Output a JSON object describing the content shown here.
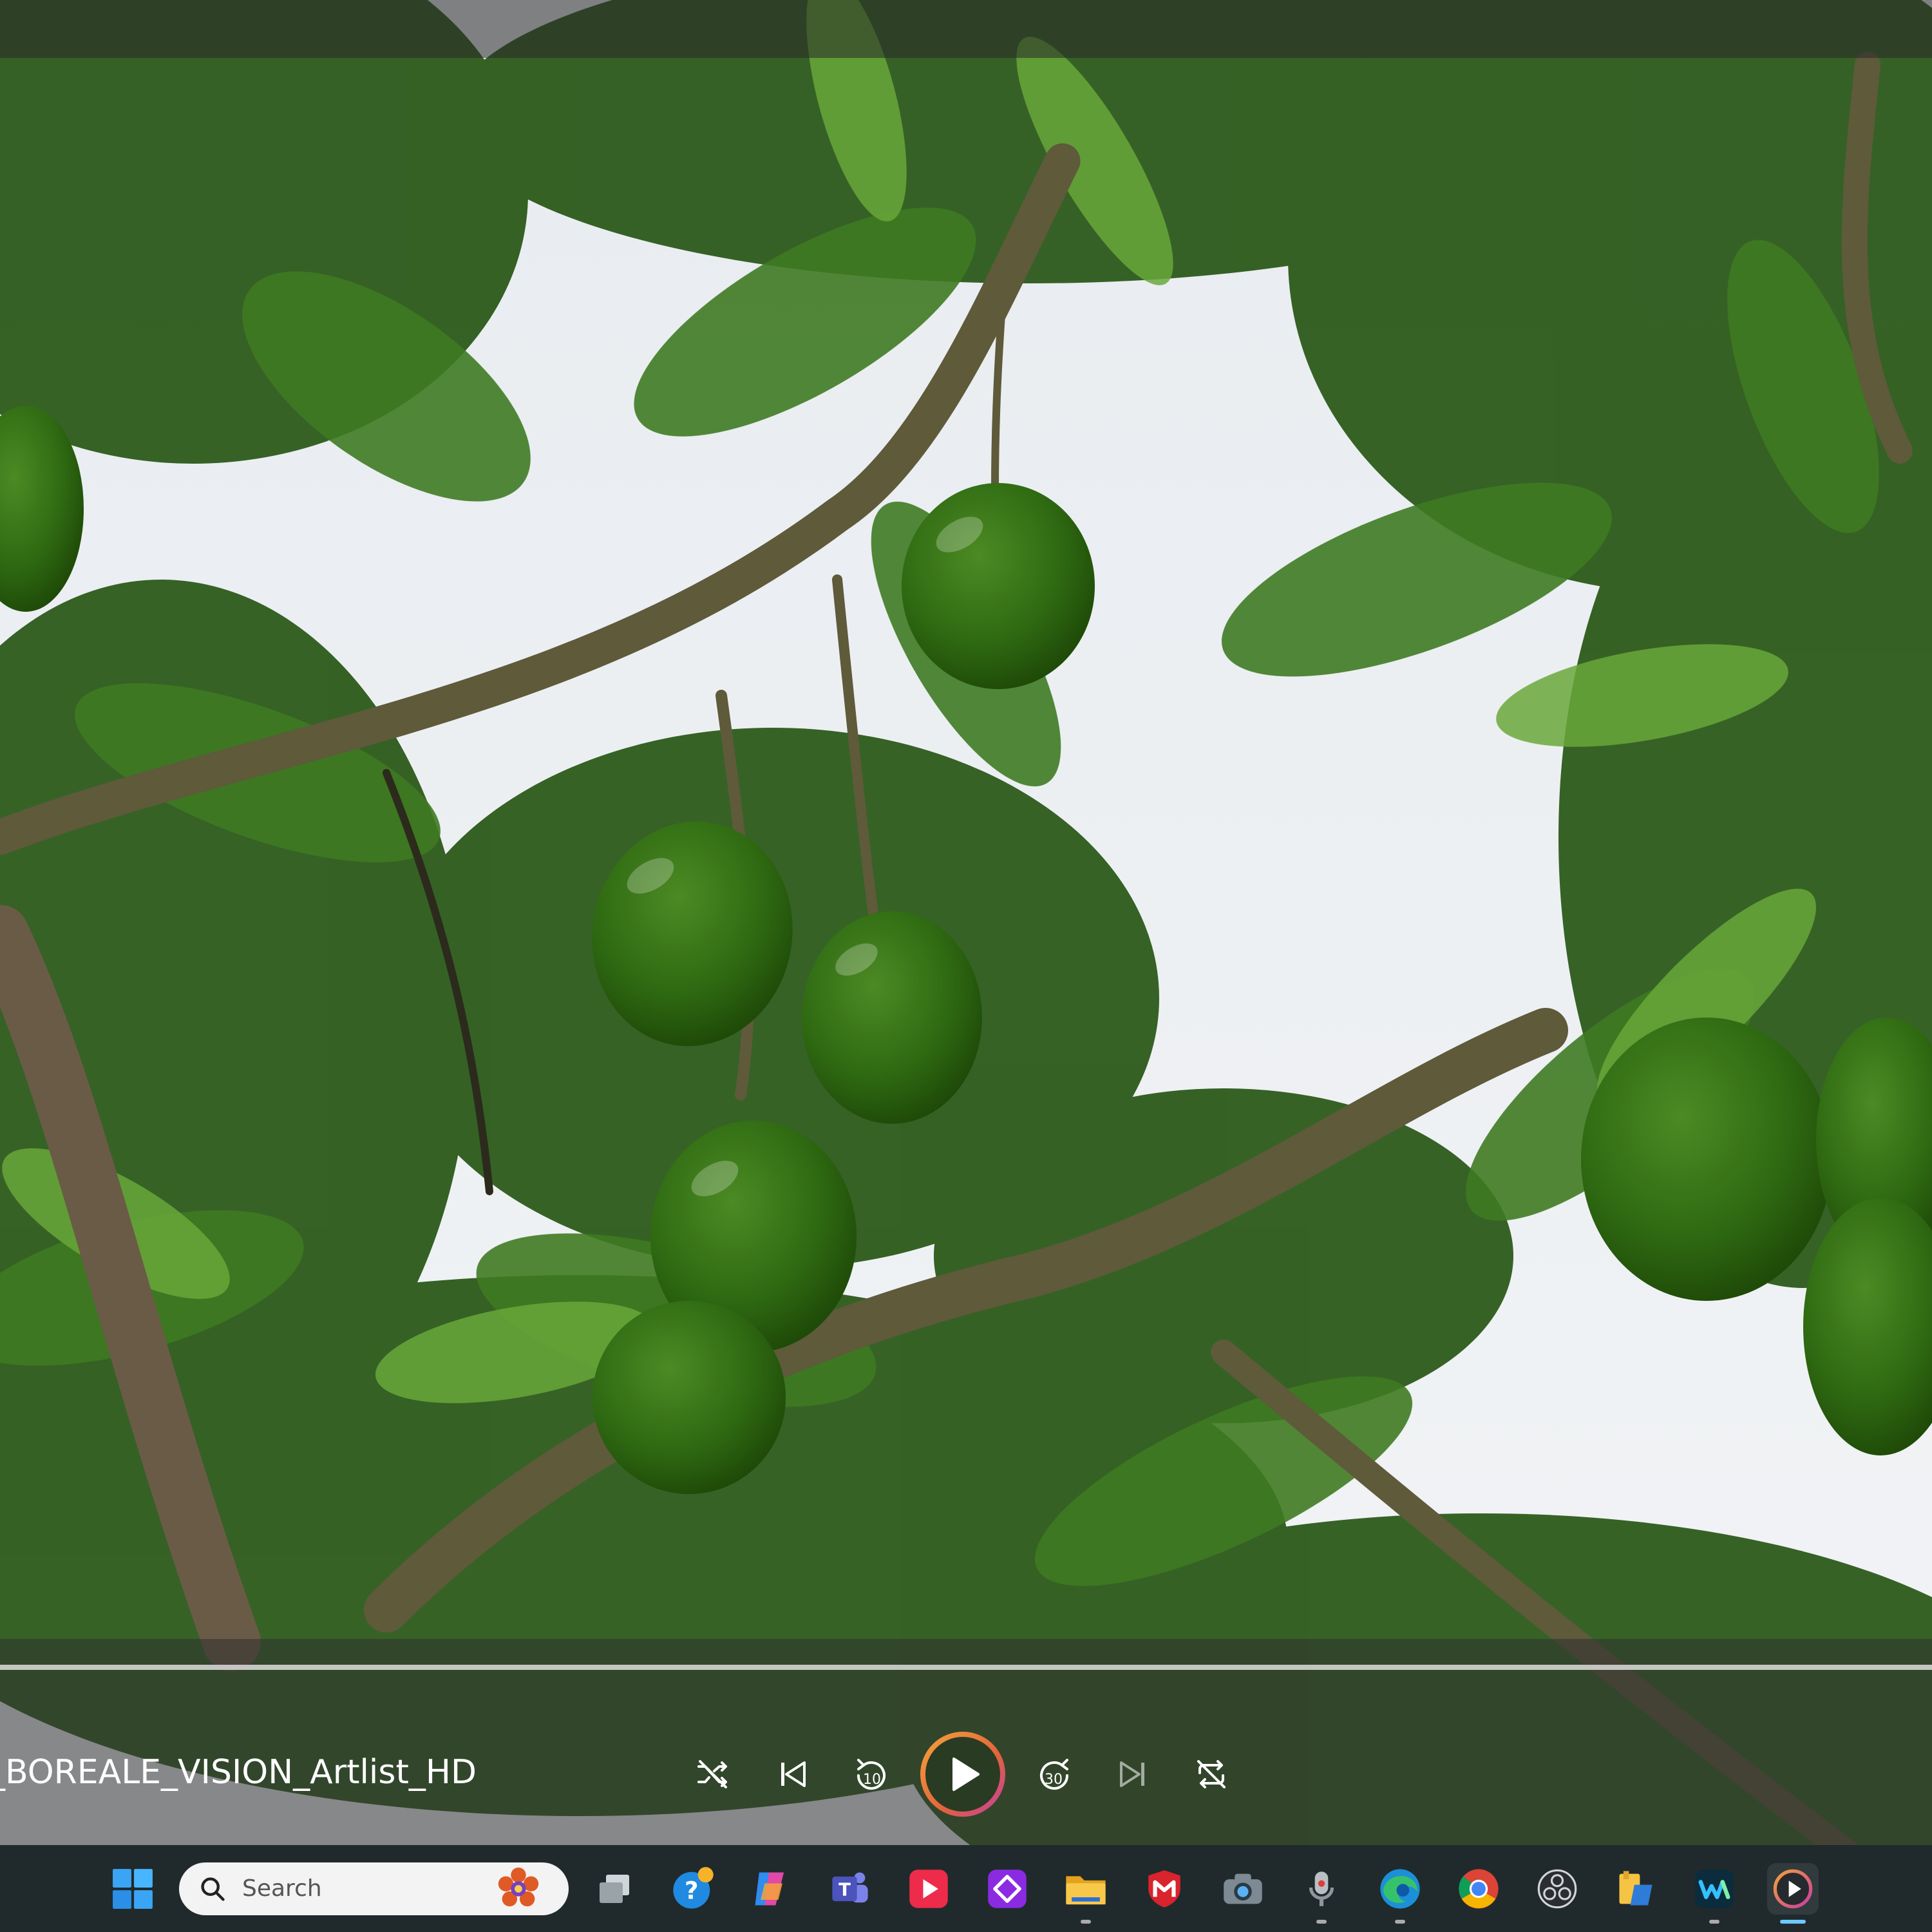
{
  "player": {
    "title": "y_BOREALE_VISION_Artlist_HD",
    "progress_fraction": 0.0,
    "skip_back_seconds": "10",
    "skip_forward_seconds": "30",
    "accent_color": "#e8902c"
  },
  "controls": [
    {
      "name": "shuffle-button",
      "icon": "shuffle-icon"
    },
    {
      "name": "previous-button",
      "icon": "skip-previous-icon"
    },
    {
      "name": "rewind-10-button",
      "icon": "rewind-10-icon"
    },
    {
      "name": "play-button",
      "icon": "play-icon"
    },
    {
      "name": "forward-30-button",
      "icon": "forward-30-icon"
    },
    {
      "name": "next-button",
      "icon": "skip-next-icon"
    },
    {
      "name": "repeat-button",
      "icon": "repeat-off-icon"
    }
  ],
  "taskbar": {
    "search_placeholder": "Search",
    "apps": [
      {
        "name": "start-button",
        "icon": "windows-logo-icon"
      },
      {
        "name": "task-view-button",
        "icon": "task-view-icon"
      },
      {
        "name": "get-help-app",
        "icon": "help-icon"
      },
      {
        "name": "copilot-app",
        "icon": "copilot-icon"
      },
      {
        "name": "teams-app",
        "icon": "teams-icon"
      },
      {
        "name": "media-app-red",
        "icon": "play-red-icon"
      },
      {
        "name": "purple-app",
        "icon": "purple-diamond-icon"
      },
      {
        "name": "file-explorer-app",
        "icon": "folder-icon"
      },
      {
        "name": "mcafee-app",
        "icon": "shield-m-icon"
      },
      {
        "name": "camera-app",
        "icon": "camera-icon"
      },
      {
        "name": "voice-recorder-app",
        "icon": "microphone-icon"
      },
      {
        "name": "edge-app",
        "icon": "edge-icon"
      },
      {
        "name": "chrome-app",
        "icon": "chrome-icon"
      },
      {
        "name": "obs-app",
        "icon": "obs-icon"
      },
      {
        "name": "files-app",
        "icon": "files-icon"
      },
      {
        "name": "webex-app",
        "icon": "webex-icon"
      },
      {
        "name": "media-player-app",
        "icon": "media-player-icon"
      }
    ]
  }
}
